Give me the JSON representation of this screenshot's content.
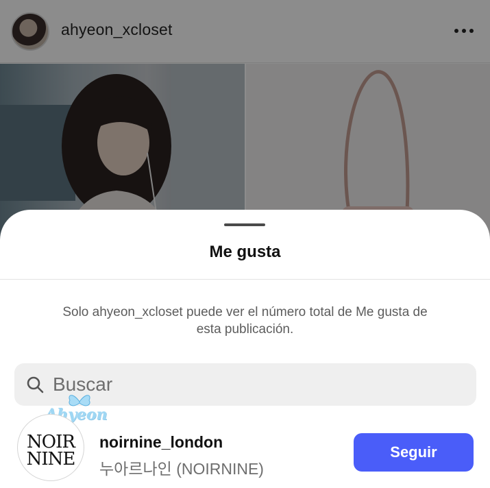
{
  "post": {
    "username": "ahyeon_xcloset"
  },
  "likes_sheet": {
    "title": "Me gusta",
    "notice": "Solo ahyeon_xcloset puede ver el número total de Me gusta de esta publicación.",
    "search": {
      "placeholder": "Buscar"
    },
    "watermark_text": "Ahyeon",
    "users": [
      {
        "username": "noirnine_london",
        "display_name": "누아르나인 (NOIRNINE)",
        "avatar_logo": [
          "NOIR",
          "NINE"
        ],
        "follow_label": "Seguir"
      }
    ]
  },
  "colors": {
    "follow_button": "#4a5df9",
    "search_bg": "#efefef",
    "watermark": "#9ed7f4"
  }
}
